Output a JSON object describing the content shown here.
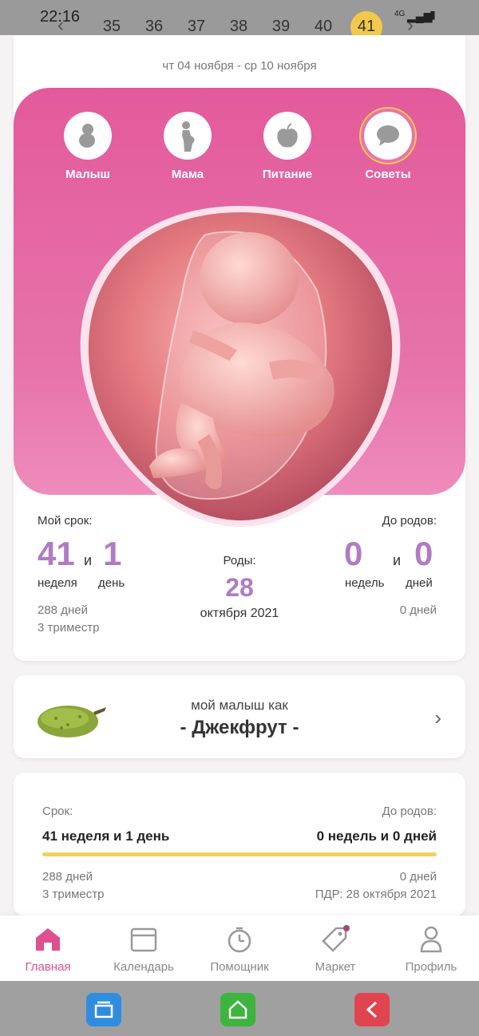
{
  "status": {
    "time": "22:16",
    "network": "4G"
  },
  "week_strip": {
    "weeks": [
      "35",
      "36",
      "37",
      "38",
      "39",
      "40",
      "41"
    ],
    "current": "41"
  },
  "date_range": "чт 04 ноября - ср 10 ноября",
  "categories": [
    {
      "label": "Малыш",
      "icon": "baby-icon"
    },
    {
      "label": "Мама",
      "icon": "mother-icon"
    },
    {
      "label": "Питание",
      "icon": "apple-icon"
    },
    {
      "label": "Советы",
      "icon": "chat-icon"
    }
  ],
  "term": {
    "title": "Мой срок:",
    "weeks": "41",
    "and": "и",
    "days": "1",
    "weeks_unit": "неделя",
    "days_unit": "день",
    "days_total": "288 дней",
    "trimester": "3 триместр"
  },
  "birth": {
    "label": "Роды:",
    "day": "28",
    "month": "октября 2021"
  },
  "until": {
    "title": "До родов:",
    "weeks": "0",
    "and": "и",
    "days": "0",
    "weeks_unit": "недель",
    "days_unit": "дней",
    "days_total": "0 дней"
  },
  "fruit": {
    "caption": "мой малыш как",
    "name": "- Джекфрут -"
  },
  "summary": {
    "term_label": "Срок:",
    "term_value": "41 неделя и 1 день",
    "until_label": "До родов:",
    "until_value": "0 недель и 0 дней",
    "progress": 1.0,
    "days_total": "288 дней",
    "trimester": "3 триместр",
    "days_left": "0 дней",
    "due_date": "ПДР: 28 октября 2021"
  },
  "bottom_nav": [
    {
      "label": "Главная",
      "icon": "home-icon",
      "active": true
    },
    {
      "label": "Календарь",
      "icon": "calendar-icon",
      "active": false
    },
    {
      "label": "Помощник",
      "icon": "stopwatch-icon",
      "active": false
    },
    {
      "label": "Маркет",
      "icon": "tag-icon",
      "active": false
    },
    {
      "label": "Профиль",
      "icon": "profile-icon",
      "active": false
    }
  ],
  "colors": {
    "accent": "#e0508f",
    "pink_panel": "#e35a9b",
    "number": "#b07bc4",
    "progress": "#f2d15c"
  }
}
